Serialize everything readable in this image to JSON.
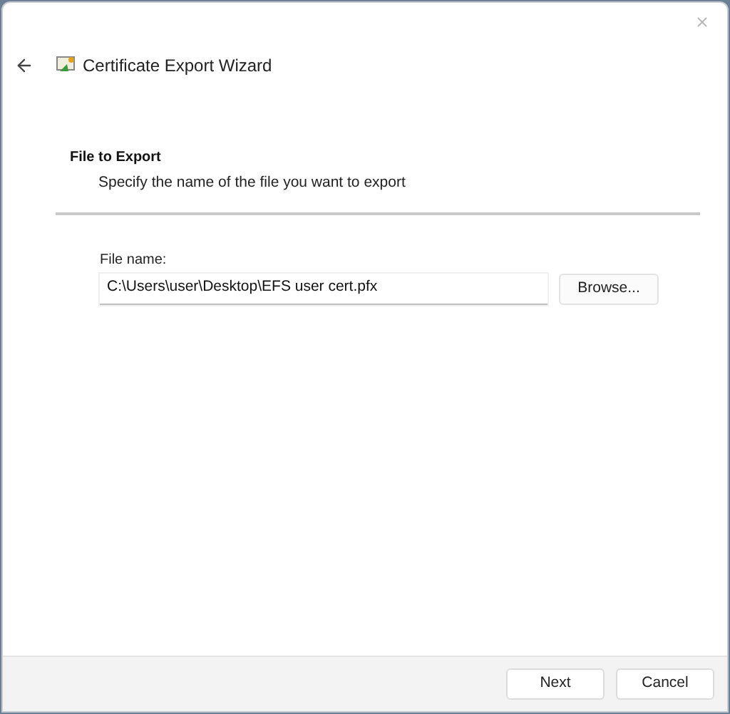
{
  "window": {
    "title": "Certificate Export Wizard"
  },
  "header": {
    "title": "File to Export",
    "subtitle": "Specify the name of the file you want to export"
  },
  "file_name": {
    "label": "File name:",
    "value": "C:\\Users\\user\\Desktop\\EFS user cert.pfx"
  },
  "browse_button": "Browse...",
  "buttons": [
    "Next",
    "Cancel"
  ]
}
